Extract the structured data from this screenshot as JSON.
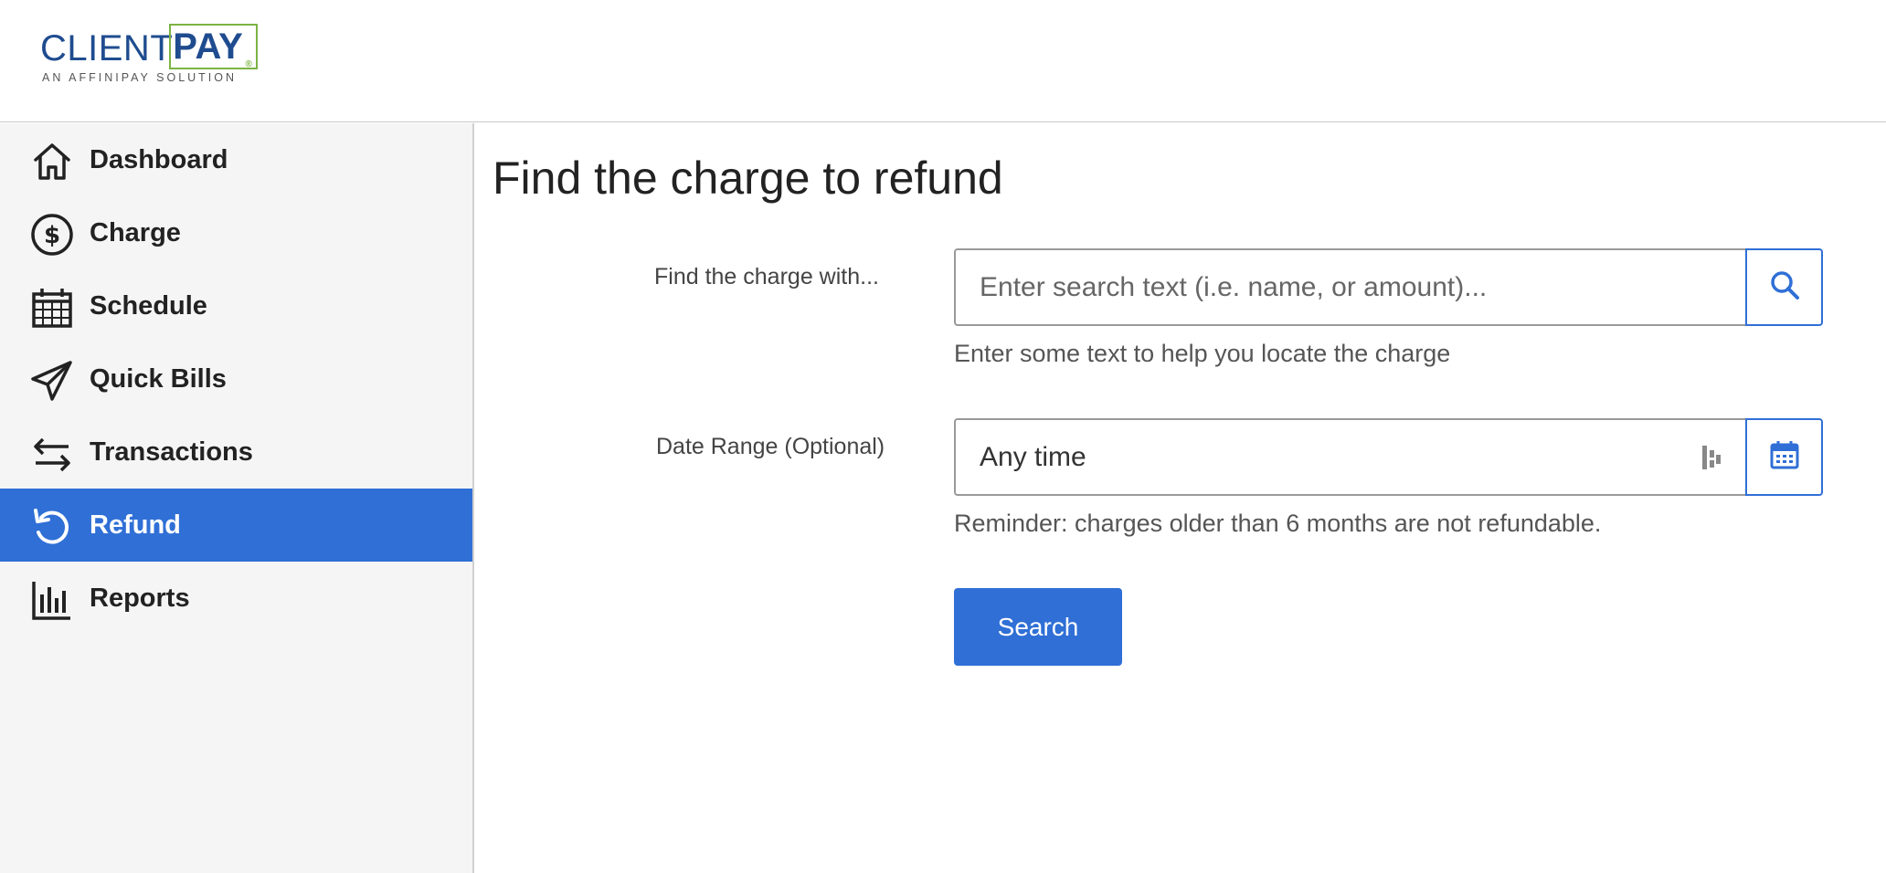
{
  "brand": {
    "name_part1": "CLIENT",
    "name_part2": "PAY",
    "registered": "®",
    "tagline": "AN AFFINIPAY SOLUTION",
    "colors": {
      "navy": "#1f4c8f",
      "green": "#7cb342"
    }
  },
  "sidebar": {
    "items": [
      {
        "label": "Dashboard",
        "icon": "home-icon",
        "active": false
      },
      {
        "label": "Charge",
        "icon": "dollar-circle-icon",
        "active": false
      },
      {
        "label": "Schedule",
        "icon": "calendar-icon",
        "active": false
      },
      {
        "label": "Quick Bills",
        "icon": "paper-plane-icon",
        "active": false
      },
      {
        "label": "Transactions",
        "icon": "arrows-exchange-icon",
        "active": false
      },
      {
        "label": "Refund",
        "icon": "refund-icon",
        "active": true
      },
      {
        "label": "Reports",
        "icon": "bar-chart-icon",
        "active": false
      }
    ],
    "active_color": "#2f6fd6"
  },
  "main": {
    "title": "Find the charge to refund",
    "search_field": {
      "label": "Find the charge with...",
      "placeholder": "Enter search text (i.e. name, or amount)...",
      "value": "",
      "help": "Enter some text to help you locate the charge",
      "button_icon": "search-icon"
    },
    "date_field": {
      "label": "Date Range (Optional)",
      "value": "Any time",
      "help": "Reminder: charges older than 6 months are not refundable.",
      "button_icon": "calendar-icon"
    },
    "search_button_label": "Search"
  }
}
